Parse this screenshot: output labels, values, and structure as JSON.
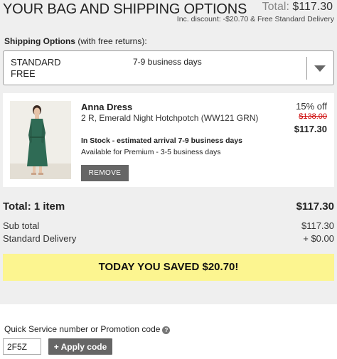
{
  "header": {
    "title": "YOUR BAG AND SHIPPING OPTIONS",
    "total_label": "Total:",
    "total_value": "$117.30",
    "discount_note": "Inc. discount: -$20.70 & Free Standard Delivery"
  },
  "shipping": {
    "label_bold": "Shipping Options",
    "label_rest": " (with free returns):",
    "selected_name": "STANDARD",
    "selected_price": "FREE",
    "selected_days": "7-9 business days",
    "caret_icon": "chevron-down-icon"
  },
  "item": {
    "name": "Anna Dress",
    "description": "2 R, Emerald Night Hotchpotch (WW121 GRN)",
    "stock": "In Stock - estimated arrival 7-9 business days",
    "premium": "Available for Premium - 3-5 business days",
    "remove_label": "REMOVE",
    "pct_off": "15% off",
    "old_price": "$138.00",
    "new_price": "$117.30"
  },
  "summary": {
    "total_label": "Total: 1 item",
    "total_value": "$117.30",
    "subtotal_label": "Sub total",
    "subtotal_value": "$117.30",
    "delivery_label": "Standard Delivery",
    "delivery_value": "+ $0.00",
    "saved_banner": "TODAY YOU SAVED $20.70!"
  },
  "promo": {
    "label": "Quick Service number or Promotion code",
    "help_icon": "question-icon",
    "help_glyph": "?",
    "input_value": "2F5Z",
    "apply_label": "+ Apply code"
  },
  "colors": {
    "panel_bg": "#efefef",
    "banner_yellow": "#fcf590",
    "button_gray": "#666666",
    "strike_red": "#cc0000",
    "dress_green": "#2f6b55"
  }
}
